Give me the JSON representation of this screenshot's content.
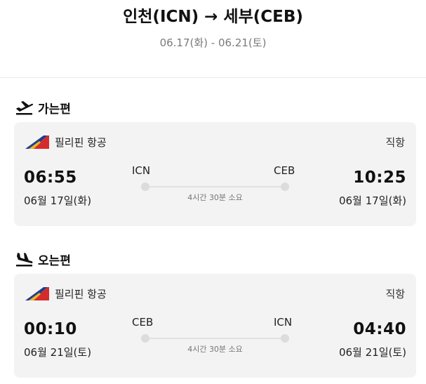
{
  "header": {
    "route": "인천(ICN) → 세부(CEB)",
    "dates": "06.17(화) - 06.21(토)"
  },
  "outbound": {
    "section_label": "가는편",
    "icon": "plane-departure-icon",
    "airline": "필리핀 항공",
    "flight_type": "직항",
    "departure": {
      "time": "06:55",
      "date": "06월 17일(화)",
      "code": "ICN"
    },
    "arrival": {
      "time": "10:25",
      "date": "06월 17일(화)",
      "code": "CEB"
    },
    "duration": "4시간 30분 소요"
  },
  "inbound": {
    "section_label": "오는편",
    "icon": "plane-arrival-icon",
    "airline": "필리핀 항공",
    "flight_type": "직항",
    "departure": {
      "time": "00:10",
      "date": "06월 21일(토)",
      "code": "CEB"
    },
    "arrival": {
      "time": "04:40",
      "date": "06월 21일(토)",
      "code": "ICN"
    },
    "duration": "4시간 30분 소요"
  },
  "colors": {
    "card_bg": "#f3f3f3",
    "logo_red": "#d62b2b",
    "logo_blue": "#1f3f8a",
    "logo_gold": "#e8b52f"
  }
}
